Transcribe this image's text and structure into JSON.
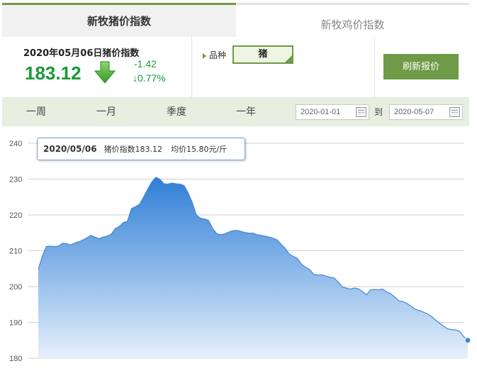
{
  "tabs": {
    "active_label": "新牧猪价指数",
    "inactive_label": "新牧鸡价指数"
  },
  "info": {
    "date_title": "2020年05月06日猪价指数",
    "price": "183.12",
    "change_abs": "-1.42",
    "change_pct": "↓0.77%",
    "variety_label": "品种",
    "variety_value": "猪",
    "refresh_label": "刷新报价"
  },
  "periods": {
    "week": "一周",
    "month": "一月",
    "quarter": "季度",
    "year": "一年"
  },
  "range": {
    "start": "2020-01-01",
    "separator": "到",
    "end": "2020-05-07"
  },
  "tooltip": {
    "date": "2020/05/06",
    "index_text": "猪价指数183.12",
    "avg_text": "均价15.80元/斤"
  },
  "colors": {
    "brand_green": "#6f9a47",
    "price_green": "#1a9a3a",
    "line_blue": "#3f86d8"
  },
  "chart_data": {
    "type": "area",
    "ylim": [
      180,
      240
    ],
    "yticks": [
      180,
      190,
      200,
      210,
      220,
      230,
      240
    ],
    "grid": true,
    "x_start": "2020-01-01",
    "x_end": "2020-05-06",
    "values": [
      204.8,
      208.5,
      211.2,
      211.3,
      211.2,
      211.3,
      212.1,
      212.0,
      211.6,
      212.2,
      212.5,
      213.0,
      213.6,
      214.3,
      213.8,
      213.4,
      213.8,
      214.1,
      214.6,
      216.2,
      216.8,
      217.9,
      218.2,
      221.8,
      222.3,
      223.0,
      225.0,
      227.2,
      229.2,
      230.5,
      230.0,
      228.7,
      228.6,
      228.9,
      228.7,
      228.6,
      228.2,
      226.1,
      223.5,
      220.0,
      219.1,
      218.9,
      218.5,
      216.3,
      214.8,
      214.5,
      214.7,
      215.2,
      215.6,
      215.7,
      215.4,
      215.1,
      214.9,
      214.9,
      214.5,
      214.3,
      214.1,
      213.8,
      213.5,
      213.0,
      211.7,
      210.6,
      209.0,
      208.4,
      207.8,
      206.2,
      205.4,
      204.7,
      203.4,
      203.2,
      203.3,
      202.9,
      202.6,
      202.4,
      201.3,
      199.9,
      199.6,
      199.3,
      199.6,
      199.4,
      198.6,
      197.7,
      199.1,
      199.2,
      199.1,
      199.3,
      198.5,
      198.0,
      197.1,
      196.0,
      195.8,
      195.3,
      194.5,
      193.7,
      193.3,
      192.9,
      192.4,
      191.7,
      190.7,
      189.8,
      189.0,
      188.2,
      188.0,
      187.9,
      187.5,
      186.0,
      185.0
    ]
  }
}
